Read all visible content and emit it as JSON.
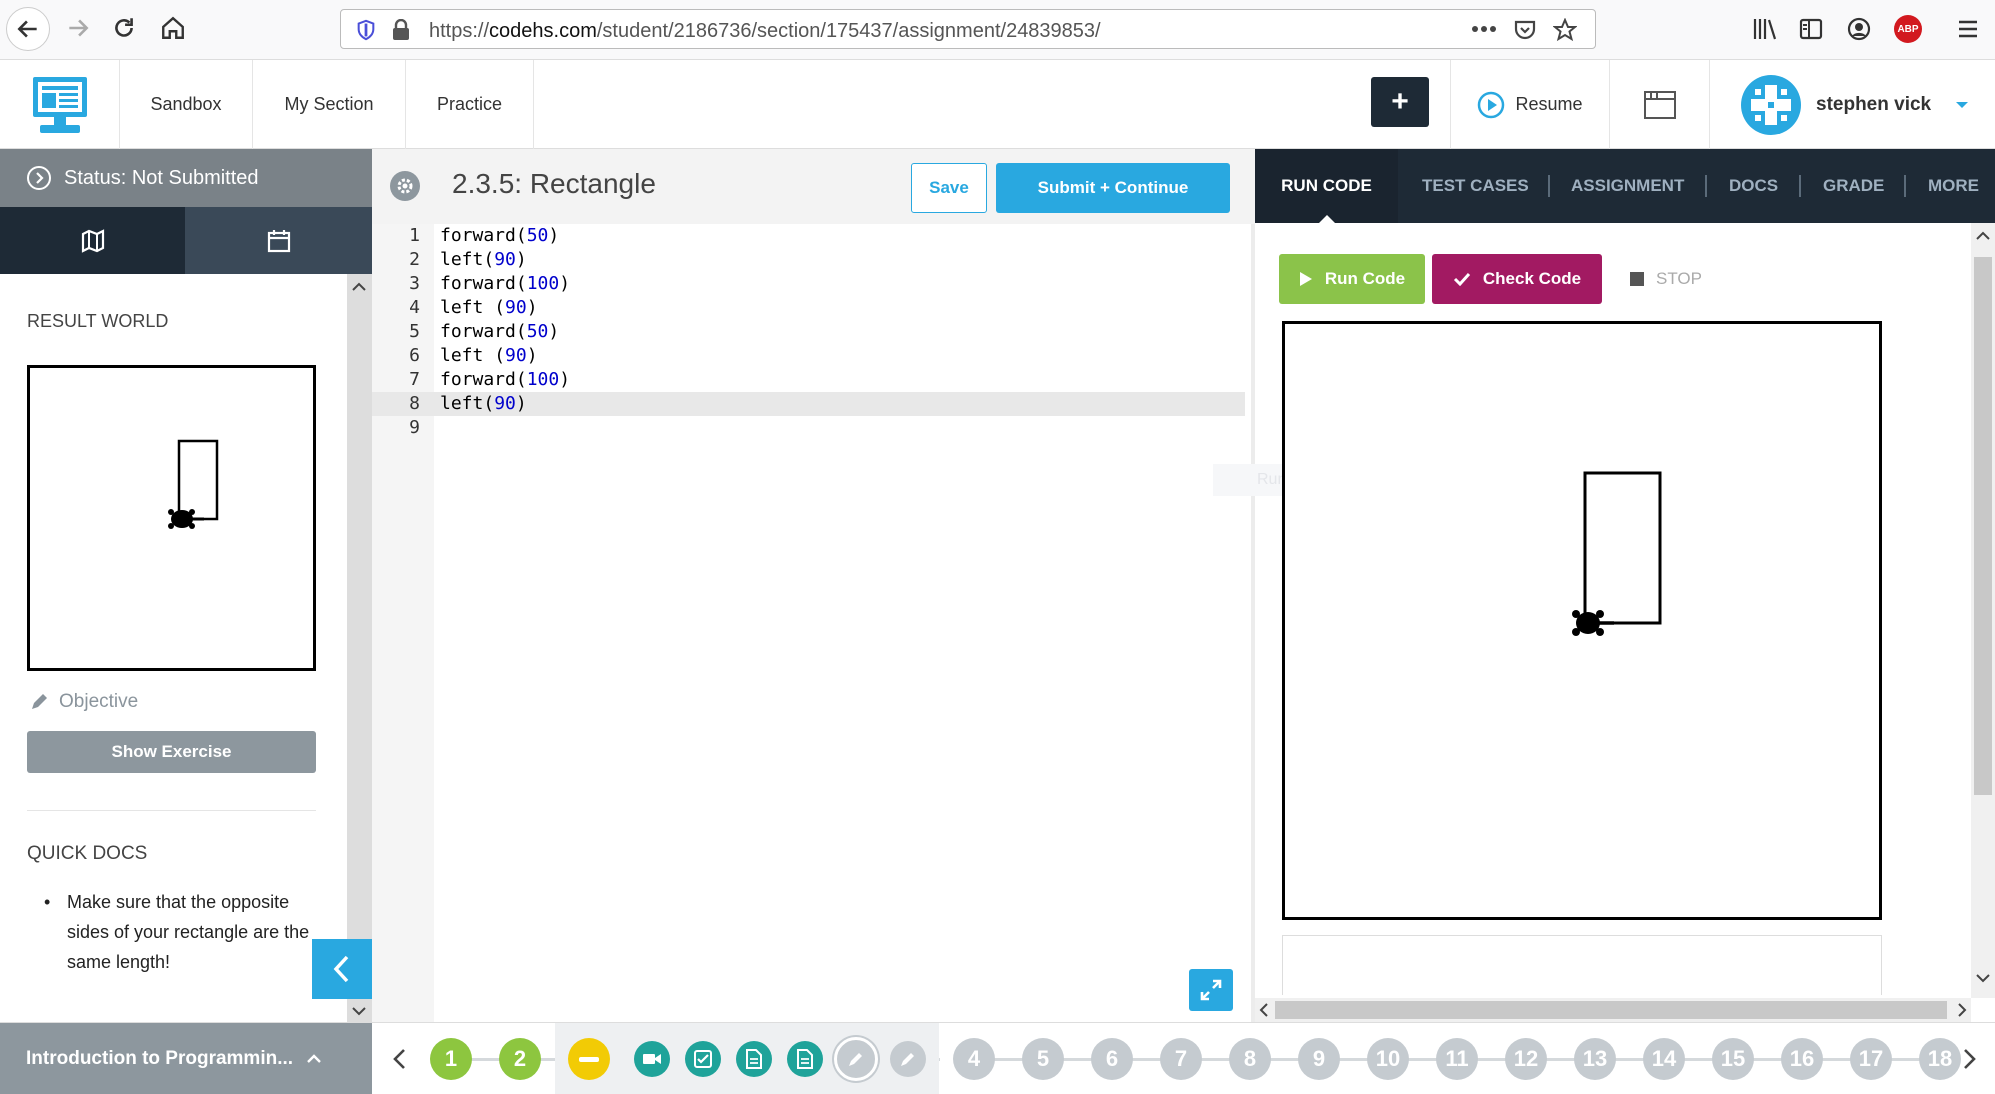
{
  "browser": {
    "url_prefix": "https://",
    "url_domain": "codehs.com",
    "url_path": "/student/2186736/section/175437/assignment/24839853/",
    "adblock_label": "ABP"
  },
  "topnav": {
    "links": [
      "Sandbox",
      "My Section",
      "Practice"
    ],
    "plus_label": "+",
    "resume_label": "Resume",
    "user_name": "stephen vick"
  },
  "left": {
    "status": "Status: Not Submitted",
    "result_world_title": "RESULT WORLD",
    "objective_label": "Objective",
    "show_exercise_label": "Show Exercise",
    "quick_docs_title": "QUICK DOCS",
    "quick_docs_item": "Make sure that the opposite sides of your rectangle are the same length!"
  },
  "editor": {
    "title": "2.3.5: Rectangle",
    "save_label": "Save",
    "submit_label": "Submit + Continue",
    "lines": [
      {
        "num": "1",
        "fn": "forward",
        "sp": "",
        "arg": "50"
      },
      {
        "num": "2",
        "fn": "left",
        "sp": "",
        "arg": "90"
      },
      {
        "num": "3",
        "fn": "forward",
        "sp": "",
        "arg": "100"
      },
      {
        "num": "4",
        "fn": "left",
        "sp": " ",
        "arg": "90"
      },
      {
        "num": "5",
        "fn": "forward",
        "sp": "",
        "arg": "50"
      },
      {
        "num": "6",
        "fn": "left",
        "sp": " ",
        "arg": "90"
      },
      {
        "num": "7",
        "fn": "forward",
        "sp": "",
        "arg": "100"
      },
      {
        "num": "8",
        "fn": "left",
        "sp": "",
        "arg": "90"
      },
      {
        "num": "9",
        "fn": "",
        "sp": "",
        "arg": ""
      }
    ]
  },
  "right": {
    "tabs": [
      "RUN CODE",
      "TEST CASES",
      "ASSIGNMENT",
      "DOCS",
      "GRADE",
      "MORE"
    ],
    "run_label": "Run Code",
    "check_label": "Check Code",
    "stop_label": "STOP",
    "faint_label": "Run Regular Step"
  },
  "bottom": {
    "course_label": "Introduction to Programmin...",
    "done_numbers": [
      "1",
      "2"
    ],
    "numbers": [
      "4",
      "5",
      "6",
      "7",
      "8",
      "9",
      "10",
      "11",
      "12",
      "13",
      "14",
      "15",
      "16",
      "17",
      "18"
    ]
  },
  "colors": {
    "accent": "#29a8e0",
    "dark_nav": "#1e2a36",
    "run_green": "#8bc34a",
    "check_magenta": "#a21a62",
    "done_green": "#8dc63f",
    "current_yellow": "#f2cb05",
    "teal": "#1fa39a"
  }
}
